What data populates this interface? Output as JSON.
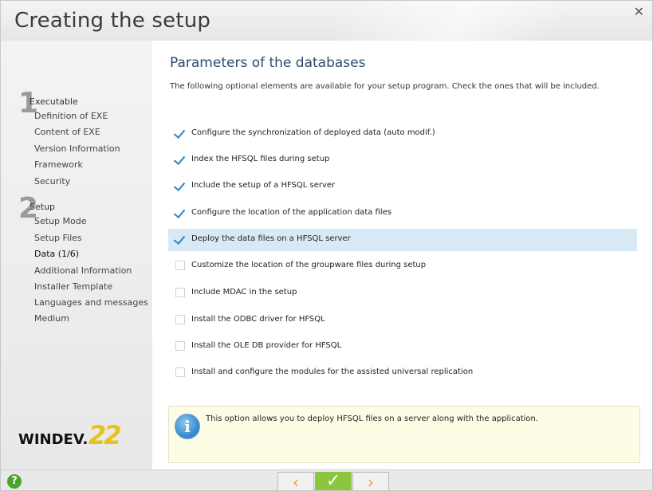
{
  "window": {
    "title": "Creating the setup",
    "close_glyph": "✕"
  },
  "sidebar": {
    "step1": {
      "number": "1",
      "title": "Executable",
      "items": [
        "Definition of EXE",
        "Content of EXE",
        "Version Information",
        "Framework",
        "Security"
      ]
    },
    "step2": {
      "number": "2",
      "title": "Setup",
      "items": [
        "Setup Mode",
        "Setup Files",
        "Data (1/6)",
        "Additional Information",
        "Installer Template",
        "Languages and messages",
        "Medium"
      ]
    },
    "logo": {
      "text": "WINDEV.",
      "version": "22"
    }
  },
  "main": {
    "title": "Parameters of the databases",
    "description": "The following optional elements are available for your setup program. Check the ones that will be included.",
    "options": [
      {
        "label": "Configure the synchronization of deployed data (auto modif.)",
        "checked": true
      },
      {
        "label": "Index the HFSQL files during setup",
        "checked": true
      },
      {
        "label": "Include the setup of a HFSQL server",
        "checked": true
      },
      {
        "label": "Configure the location of the application data files",
        "checked": true
      },
      {
        "label": "Deploy the data files on a HFSQL server",
        "checked": true,
        "selected": true
      },
      {
        "label": "Customize the location of the groupware files during setup",
        "checked": false
      },
      {
        "label": "Include MDAC in the setup",
        "checked": false
      },
      {
        "label": "Install the ODBC driver for HFSQL",
        "checked": false
      },
      {
        "label": "Install the OLE DB provider for HFSQL",
        "checked": false
      },
      {
        "label": "Install and configure the modules for the assisted universal replication",
        "checked": false
      }
    ],
    "info": {
      "icon": "info-icon",
      "icon_glyph": "i",
      "text": "This option allows you to deploy HFSQL files on a server along with the application."
    }
  },
  "footer": {
    "help_glyph": "?",
    "prev_glyph": "‹",
    "ok_glyph": "✓",
    "next_glyph": "›"
  },
  "colors": {
    "accent": "#2a86c7",
    "selection": "#d7e9f4",
    "ok_button": "#8cc63f",
    "nav_arrow": "#f0a31a",
    "help_button": "#49a52f",
    "info_background": "#fdfde6"
  }
}
